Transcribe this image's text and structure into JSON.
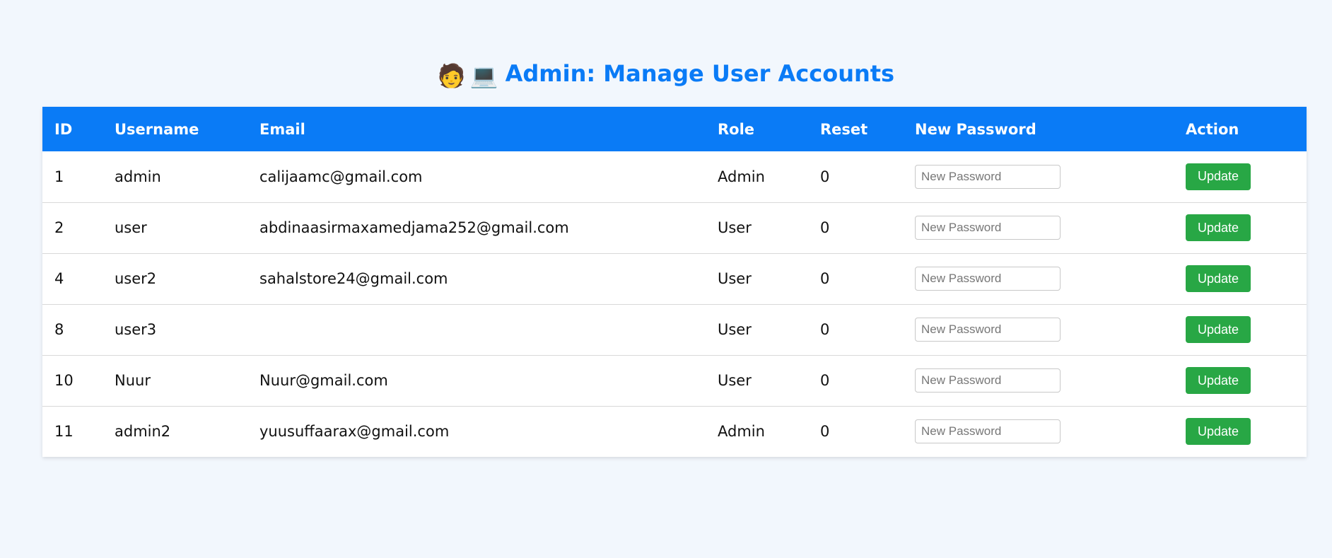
{
  "header": {
    "icons": [
      "boy-face-icon",
      "laptop-icon"
    ],
    "title": "Admin: Manage User Accounts"
  },
  "table": {
    "columns": [
      "ID",
      "Username",
      "Email",
      "Role",
      "Reset",
      "New Password",
      "Action"
    ],
    "rows": [
      {
        "id": "1",
        "username": "admin",
        "email": "calijaamc@gmail.com",
        "role": "Admin",
        "reset": "0"
      },
      {
        "id": "2",
        "username": "user",
        "email": "abdinaasirmaxamedjama252@gmail.com",
        "role": "User",
        "reset": "0"
      },
      {
        "id": "4",
        "username": "user2",
        "email": "sahalstore24@gmail.com",
        "role": "User",
        "reset": "0"
      },
      {
        "id": "8",
        "username": "user3",
        "email": "",
        "role": "User",
        "reset": "0"
      },
      {
        "id": "10",
        "username": "Nuur",
        "email": "Nuur@gmail.com",
        "role": "User",
        "reset": "0"
      },
      {
        "id": "11",
        "username": "admin2",
        "email": "yuusuffaarax@gmail.com",
        "role": "Admin",
        "reset": "0"
      }
    ],
    "password_placeholder": "New Password",
    "password_value": "",
    "update_label": "Update"
  },
  "colors": {
    "accent": "#0a7bf6",
    "button": "#28a745",
    "background": "#f2f7fd"
  }
}
